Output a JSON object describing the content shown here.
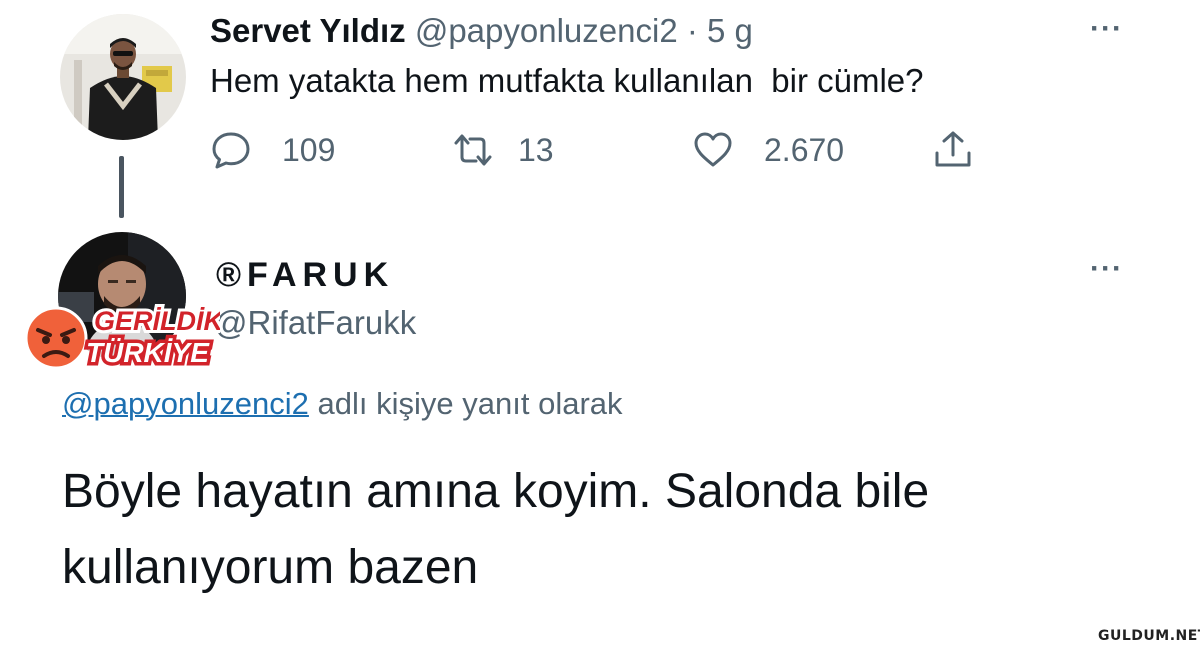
{
  "tweet": {
    "author_name": "Servet Yıldız",
    "author_handle": "@papyonluzenci2",
    "separator": "·",
    "time": "5 g",
    "text": "Hem yatakta hem mutfakta kullanılan  bir cümle?",
    "more_icon": "···",
    "reply_count": "109",
    "retweet_count": "13",
    "like_count": "2.670"
  },
  "reply": {
    "author_name": "®FARUK",
    "author_handle": "@RifatFarukk",
    "more_icon": "···",
    "replying_to_handle": "@papyonluzenci2",
    "replying_to_suffix": " adlı kişiye yanıt olarak",
    "text": "Böyle hayatın amına koyim. Salonda bile kullanıyorum bazen"
  },
  "sticker": {
    "line1": "GERİLDİK",
    "line2": "TÜRKİYE"
  },
  "watermark": "GULDUM.NET",
  "icons": {
    "reply": "speech-bubble-icon",
    "retweet": "retweet-arrows-icon",
    "like": "heart-icon",
    "share": "share-upload-icon",
    "more": "ellipsis-icon"
  },
  "colors": {
    "text_primary": "#0f1419",
    "text_secondary": "#536471",
    "mention_link": "#1d6fb0",
    "sticker_red": "#d2232a",
    "sticker_emoji": "#f0613a"
  }
}
